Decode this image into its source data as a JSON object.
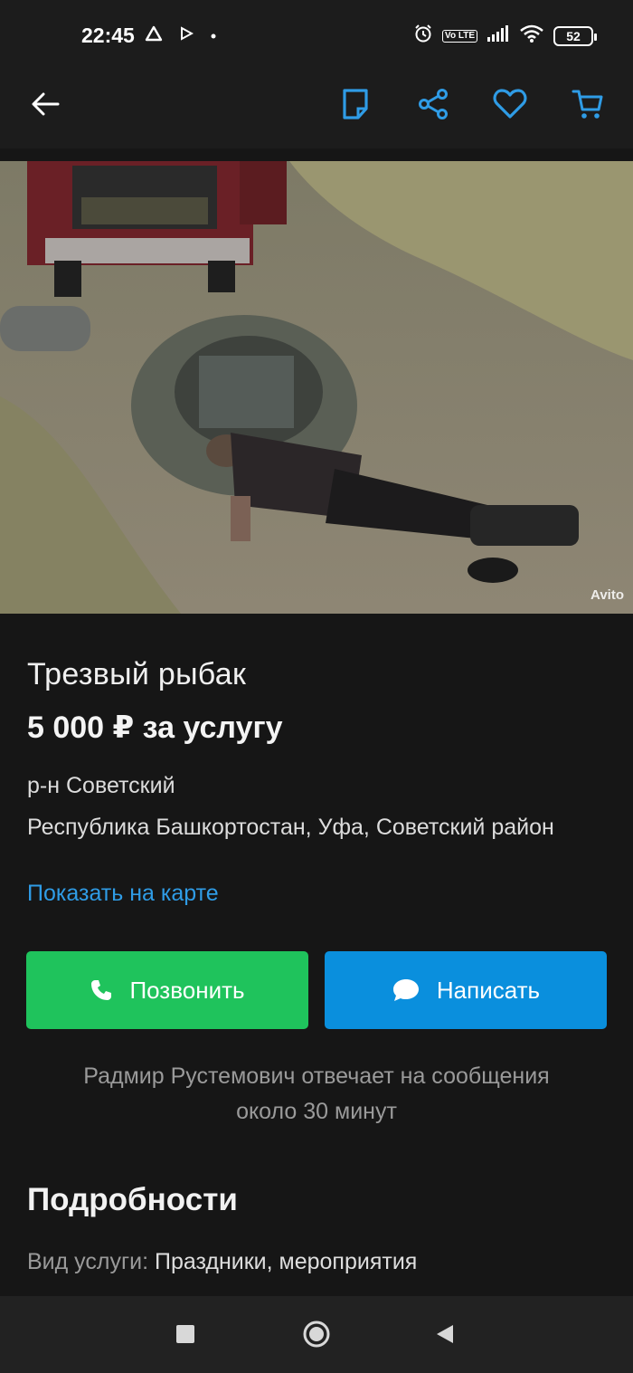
{
  "status_bar": {
    "time": "22:45",
    "network_badge": "Vo LTE",
    "battery": "52",
    "icons": [
      "drive-icon",
      "play-icon",
      "dot-icon",
      "alarm-icon",
      "volte-icon",
      "signal-icon",
      "wifi-icon",
      "battery-icon"
    ]
  },
  "toolbar": {
    "icons": [
      "back-arrow-icon",
      "note-icon",
      "share-icon",
      "heart-icon",
      "cart-icon"
    ],
    "accent": "#2f9ce6"
  },
  "photo": {
    "watermark": "Avito"
  },
  "listing": {
    "title": "Трезвый рыбак",
    "price": "5 000 ₽ за услугу",
    "district": "р-н Советский",
    "address": "Республика Башкортостан, Уфа, Советский район",
    "map_link": "Показать на карте"
  },
  "actions": {
    "call_label": "Позвонить",
    "write_label": "Написать",
    "call_color": "#1fc35c",
    "write_color": "#0a8fdd"
  },
  "seller": {
    "reply_line1": "Радмир Рустемович отвечает на сообщения",
    "reply_line2": "около 30 минут"
  },
  "details": {
    "heading": "Подробности",
    "key": "Вид услуги:",
    "value": "Праздники, мероприятия"
  },
  "nav": {
    "icons": [
      "recents-square-icon",
      "home-circle-icon",
      "back-triangle-icon"
    ]
  }
}
